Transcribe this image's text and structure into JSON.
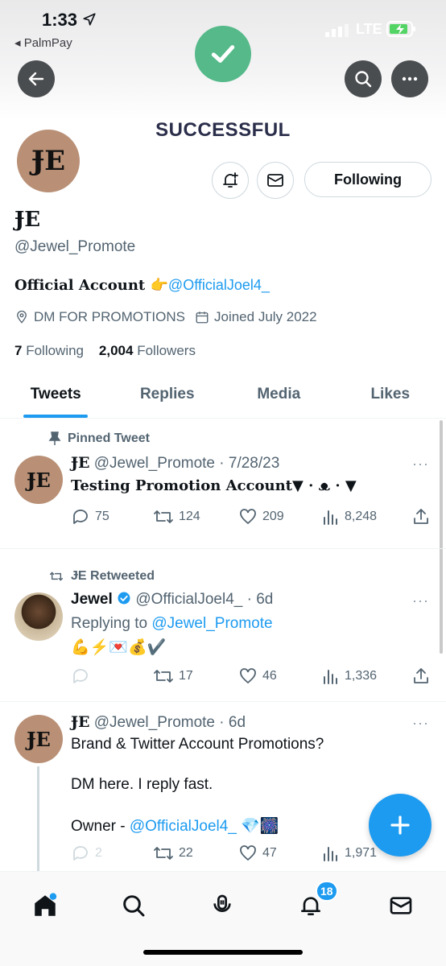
{
  "status_bar": {
    "time": "1:33",
    "back_app": "PalmPay",
    "network": "LTE"
  },
  "header": {
    "toast": "SUCCESSFUL"
  },
  "profile": {
    "display_name": "ɈE",
    "handle": "@Jewel_Promote",
    "avatar_text": "ɈE",
    "following_button": "Following",
    "bio_text": "Official Account 👉",
    "bio_link": "@OfficialJoel4_",
    "location": "DM FOR PROMOTIONS",
    "joined": "Joined July 2022",
    "following_count": "7",
    "following_label": "Following",
    "followers_count": "2,004",
    "followers_label": "Followers"
  },
  "tabs": [
    "Tweets",
    "Replies",
    "Media",
    "Likes"
  ],
  "tweets": [
    {
      "context": "Pinned Tweet",
      "name": "ɈE",
      "meta": "@Jewel_Promote · 7/28/23",
      "body": "Testing Promotion Account▼ · ᴥ · ▼",
      "replies": "75",
      "retweets": "124",
      "likes": "209",
      "views": "8,248"
    },
    {
      "context": "ɈE Retweeted",
      "name": "Jewel",
      "meta": "@OfficialJoel4_ · 6d",
      "replying_label": "Replying to",
      "replying_to": "@Jewel_Promote",
      "body": "💪⚡💌💰✔️",
      "replies": "",
      "retweets": "17",
      "likes": "46",
      "views": "1,336"
    },
    {
      "name": "ɈE",
      "meta": "@Jewel_Promote · 6d",
      "body_line1": "Brand & Twitter Account Promotions?",
      "body_line2": "DM here. I reply fast.",
      "owner_label": "Owner -",
      "owner_link": "@OfficialJoel4_",
      "owner_emoji": "💎🎆",
      "replies": "2",
      "retweets": "22",
      "likes": "47",
      "views": "1,971"
    }
  ],
  "nav": {
    "notifications_badge": "18"
  }
}
